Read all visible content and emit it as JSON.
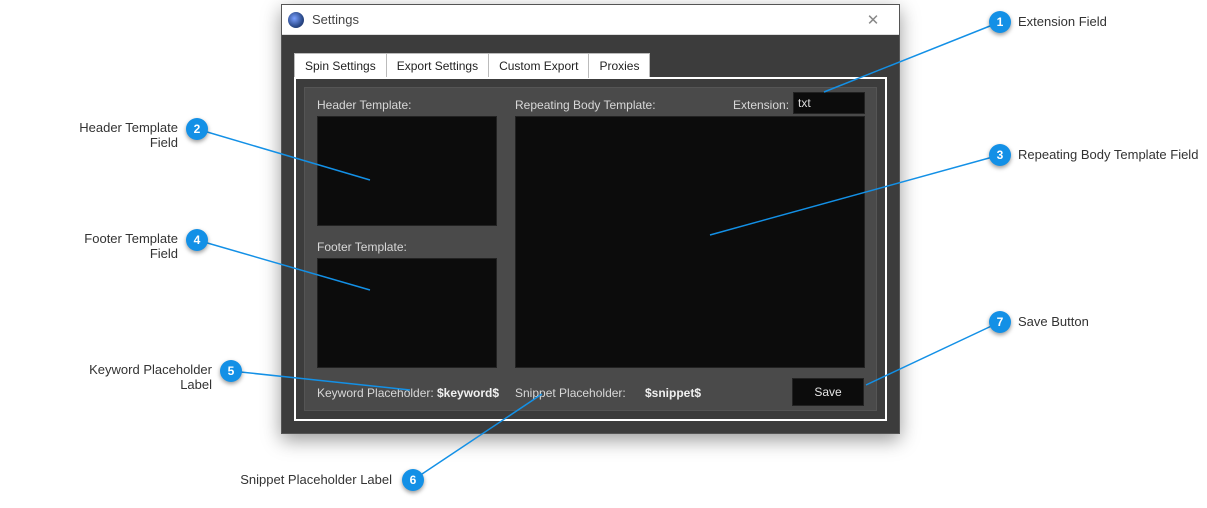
{
  "window": {
    "title": "Settings"
  },
  "tabs": {
    "spin": "Spin Settings",
    "export": "Export Settings",
    "custom": "Custom Export",
    "proxies": "Proxies"
  },
  "labels": {
    "header_template": "Header Template:",
    "footer_template": "Footer Template:",
    "repeating_body": "Repeating Body Template:",
    "extension": "Extension:",
    "keyword_placeholder": "Keyword Placeholder:",
    "snippet_placeholder": "Snippet Placeholder:",
    "save": "Save"
  },
  "values": {
    "extension": "txt",
    "keyword_placeholder": "$keyword$",
    "snippet_placeholder": "$snippet$",
    "header_template": "",
    "footer_template": "",
    "repeating_body": ""
  },
  "callouts": {
    "c1": "Extension Field",
    "c2": "Header Template Field",
    "c3": "Repeating Body Template Field",
    "c4": "Footer Template Field",
    "c5": "Keyword Placeholder Label",
    "c6": "Snippet Placeholder Label",
    "c7": "Save Button"
  }
}
